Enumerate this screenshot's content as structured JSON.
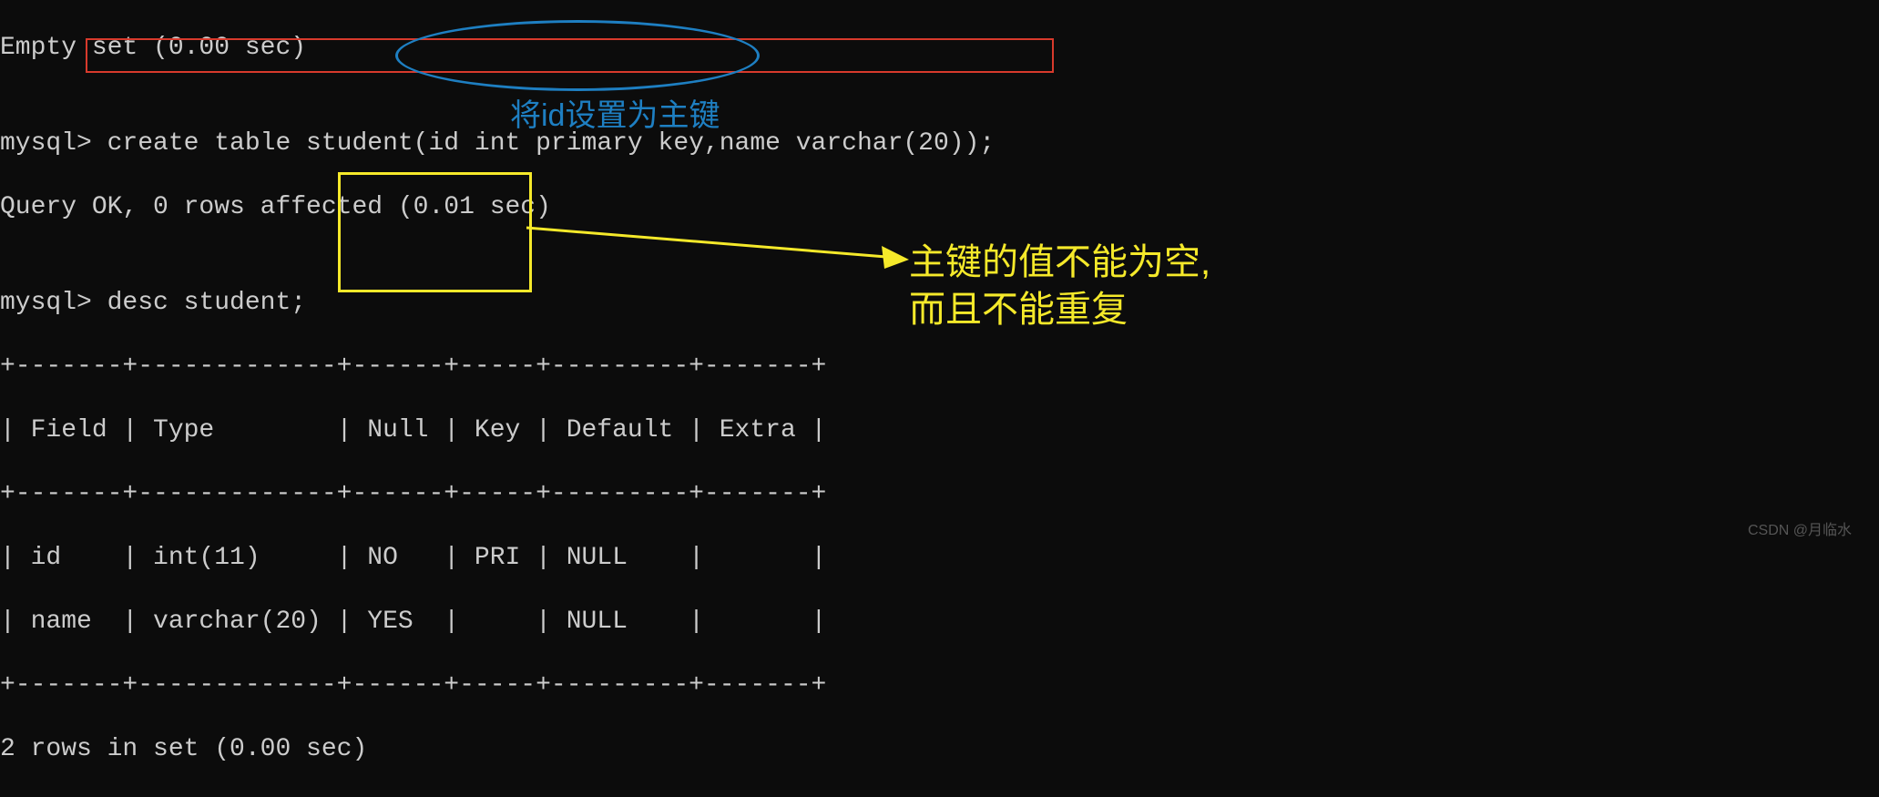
{
  "terminal": {
    "line0": "Empty set (0.00 sec)",
    "line1": "",
    "line2_prompt": "mysql> ",
    "line2_cmd": "create table student(id int primary key,name varchar(20));",
    "line3": "Query OK, 0 rows affected (0.01 sec)",
    "line4": "",
    "line5_prompt": "mysql> ",
    "line5_cmd": "desc student;",
    "tbl_border_top": "+-------+-------------+------+-----+---------+-------+",
    "tbl_header": "| Field | Type        | Null | Key | Default | Extra |",
    "tbl_border_mid": "+-------+-------------+------+-----+---------+-------+",
    "tbl_row1": "| id    | int(11)     | NO   | PRI | NULL    |       |",
    "tbl_row2": "| name  | varchar(20) | YES  |     | NULL    |       |",
    "tbl_border_bot": "+-------+-------------+------+-----+---------+-------+",
    "result_count": "2 rows in set (0.00 sec)"
  },
  "annotations": {
    "blue_text": "将id设置为主键",
    "yellow_text_l1": "主键的值不能为空,",
    "yellow_text_l2": "而且不能重复"
  },
  "watermark": "CSDN @月临水",
  "chart_data": {
    "type": "table",
    "title": "desc student;",
    "columns": [
      "Field",
      "Type",
      "Null",
      "Key",
      "Default",
      "Extra"
    ],
    "rows": [
      {
        "Field": "id",
        "Type": "int(11)",
        "Null": "NO",
        "Key": "PRI",
        "Default": "NULL",
        "Extra": ""
      },
      {
        "Field": "name",
        "Type": "varchar(20)",
        "Null": "YES",
        "Key": "",
        "Default": "NULL",
        "Extra": ""
      }
    ]
  }
}
